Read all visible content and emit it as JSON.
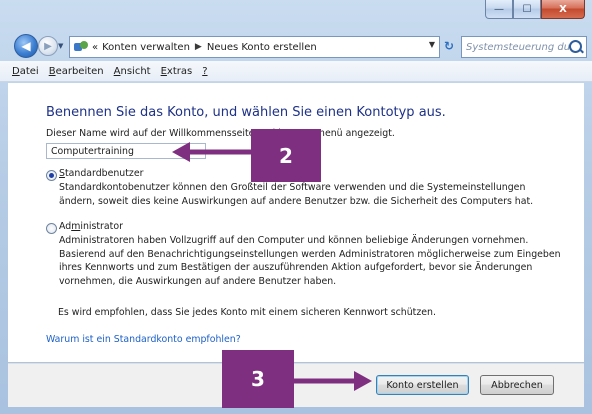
{
  "window": {
    "caption_buttons": {
      "minimize": "—",
      "maximize": "☐",
      "close": "X"
    }
  },
  "nav": {
    "breadcrumb": {
      "overflow": "«",
      "part1": "Konten verwalten",
      "sep": "▶",
      "part2": "Neues Konto erstellen"
    },
    "search_placeholder": "Systemsteuerung durc...",
    "refresh_glyph": "↻"
  },
  "menu": {
    "items": [
      {
        "label": "Datei",
        "ul": "D",
        "rest": "atei"
      },
      {
        "label": "Bearbeiten",
        "ul": "B",
        "rest": "earbeiten"
      },
      {
        "label": "Ansicht",
        "ul": "A",
        "rest": "nsicht"
      },
      {
        "label": "Extras",
        "ul": "E",
        "rest": "xtras"
      },
      {
        "label": "?",
        "ul": "?",
        "rest": ""
      }
    ]
  },
  "main": {
    "heading": "Benennen Sie das Konto, und wählen Sie einen Kontotyp aus.",
    "name_description": "Dieser Name wird auf der Willkommensseite und im Startmenü angezeigt.",
    "name_value": "Computertraining",
    "standard": {
      "label_ul": "S",
      "label_rest": "tandardbenutzer",
      "label": "Standardbenutzer",
      "checked": true,
      "desc": [
        "Standardkontobenutzer können den Großteil der Software verwenden und die Systemeinstellungen",
        "ändern, soweit dies keine Auswirkungen auf andere Benutzer bzw. die Sicherheit des Computers hat."
      ]
    },
    "admin": {
      "label_pre": "Ad",
      "label_ul": "m",
      "label_rest": "inistrator",
      "label": "Administrator",
      "checked": false,
      "desc": [
        "Administratoren haben Vollzugriff auf den Computer und können beliebige Änderungen vornehmen.",
        "Basierend auf den Benachrichtigungseinstellungen werden Administratoren möglicherweise zum Eingeben",
        "ihres Kennworts und zum Bestätigen der auszuführenden Aktion aufgefordert, bevor sie Änderungen",
        "vornehmen, die Auswirkungen auf andere Benutzer haben."
      ]
    },
    "recommendation": "Es wird empfohlen, dass Sie jedes Konto mit einem sicheren Kennwort schützen.",
    "help_link": "Warum ist ein Standardkonto empfohlen?"
  },
  "footer": {
    "create_button": "Konto erstellen",
    "cancel_button": "Abbrechen"
  },
  "annotations": {
    "step2": "2",
    "step3": "3",
    "color": "#7e2f7f"
  }
}
